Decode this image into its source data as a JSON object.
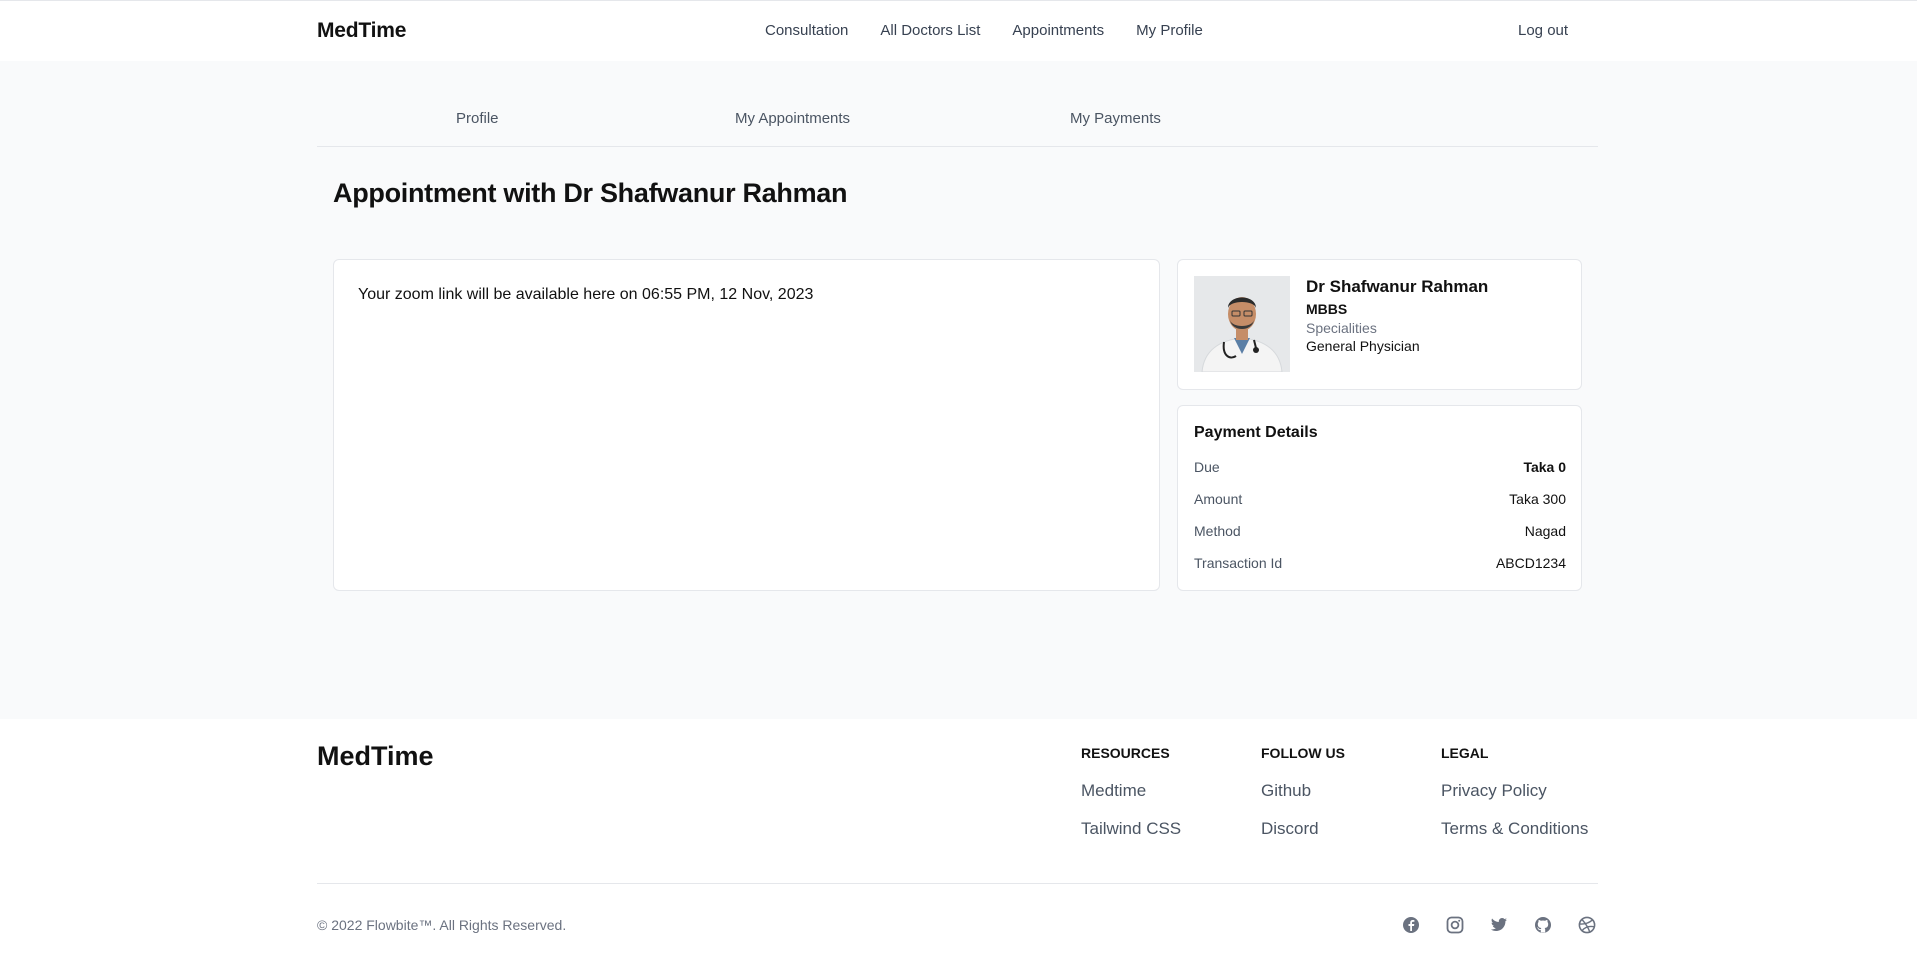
{
  "header": {
    "brand": "MedTime",
    "nav": [
      "Consultation",
      "All Doctors List",
      "Appointments",
      "My Profile"
    ],
    "logout": "Log out"
  },
  "tabs": [
    "Profile",
    "My Appointments",
    "My Payments"
  ],
  "page": {
    "title": "Appointment with Dr Shafwanur Rahman",
    "zoom_message": "Your zoom link will be available here on 06:55 PM, 12 Nov, 2023"
  },
  "doctor": {
    "name": "Dr Shafwanur Rahman",
    "degree": "MBBS",
    "specialities_label": "Specialities",
    "speciality": "General Physician"
  },
  "payment": {
    "title": "Payment Details",
    "rows": [
      {
        "label": "Due",
        "value": "Taka 0"
      },
      {
        "label": "Amount",
        "value": "Taka 300"
      },
      {
        "label": "Method",
        "value": "Nagad"
      },
      {
        "label": "Transaction Id",
        "value": "ABCD1234"
      }
    ]
  },
  "footer": {
    "brand": "MedTime",
    "columns": [
      {
        "heading": "RESOURCES",
        "links": [
          "Medtime",
          "Tailwind CSS"
        ]
      },
      {
        "heading": "FOLLOW US",
        "links": [
          "Github",
          "Discord"
        ]
      },
      {
        "heading": "LEGAL",
        "links": [
          "Privacy Policy",
          "Terms & Conditions"
        ]
      }
    ],
    "copyright": "© 2022 Flowbite™. All Rights Reserved.",
    "social_icons": [
      "facebook-icon",
      "instagram-icon",
      "twitter-icon",
      "github-icon",
      "dribbble-icon"
    ]
  },
  "colors": {
    "page_bg": "#f9fafb",
    "text_muted": "#6b7280",
    "border": "#e5e7eb"
  }
}
